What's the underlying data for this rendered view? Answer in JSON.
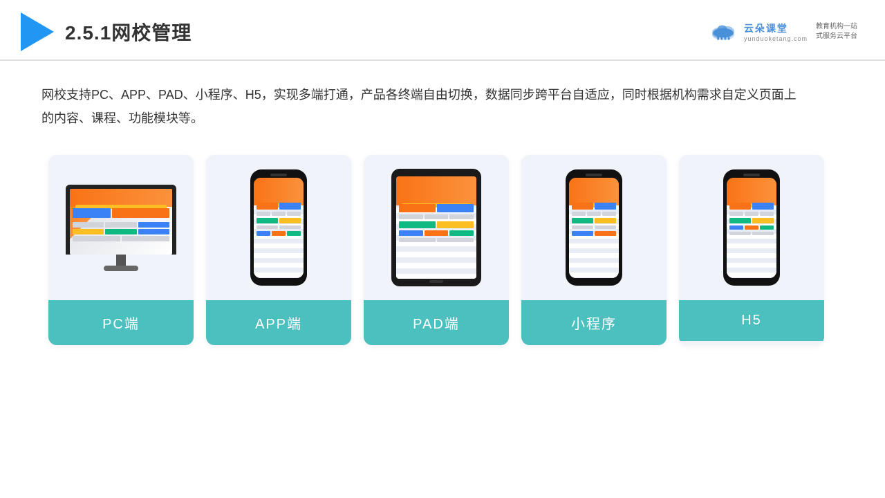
{
  "header": {
    "title": "2.5.1网校管理",
    "brand": {
      "name": "云朵课堂",
      "domain": "yunduoketang.com",
      "slogan_line1": "教育机构一站",
      "slogan_line2": "式服务云平台"
    }
  },
  "main": {
    "description": "网校支持PC、APP、PAD、小程序、H5，实现多端打通，产品各终端自由切换，数据同步跨平台自适应，同时根据机构需求自定义页面上的内容、课程、功能模块等。",
    "cards": [
      {
        "id": "pc",
        "label": "PC端"
      },
      {
        "id": "app",
        "label": "APP端"
      },
      {
        "id": "pad",
        "label": "PAD端"
      },
      {
        "id": "miniapp",
        "label": "小程序"
      },
      {
        "id": "h5",
        "label": "H5"
      }
    ]
  }
}
